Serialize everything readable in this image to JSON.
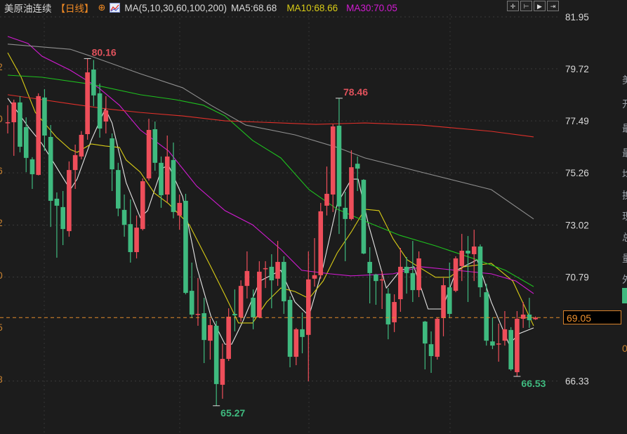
{
  "header": {
    "symbol": "美原油连续",
    "period": "【日线】",
    "crosshair_icon": "target-icon",
    "indicator_icon": "indicator-chart-icon",
    "indicator": "MA(5,10,30,60,100,200)",
    "ma5": "MA5:68.68",
    "ma10": "MA10:68.66",
    "ma30": "MA30:70.05",
    "tools": [
      "crosshair-icon",
      "zoom-range-icon",
      "play-icon",
      "jump-end-icon"
    ]
  },
  "colors": {
    "background": "#1c1c1c",
    "up": "#ee4e5a",
    "down": "#3fba7f",
    "ma5": "#e6e6e6",
    "ma10": "#d9cc16",
    "ma30": "#d21bd2",
    "ma_green": "#1ec01e",
    "ma_red": "#e0302a",
    "ma_gray": "#8f8f8f",
    "last_price": "#e28a2b"
  },
  "left_axis_fragments": [
    "2",
    "0",
    "6",
    "2",
    "0",
    "5",
    "8"
  ],
  "right_panel_fragments": [
    "美",
    "开",
    "最",
    "最",
    "均",
    "换",
    "现",
    "总",
    "量",
    "外",
    "0"
  ],
  "chart_data": {
    "type": "candlestick",
    "y_axis": {
      "ticks": [
        "81.95",
        "79.72",
        "77.49",
        "75.26",
        "73.02",
        "70.79",
        "66.33"
      ],
      "range": [
        64.9,
        82.1
      ],
      "position": "right"
    },
    "grid": true,
    "last_price": "69.05",
    "annotations": [
      {
        "text": "80.16",
        "index": 13,
        "kind": "high"
      },
      {
        "text": "78.46",
        "index": 54,
        "kind": "high"
      },
      {
        "text": "65.27",
        "index": 34,
        "kind": "low"
      },
      {
        "text": "66.53",
        "index": 83,
        "kind": "low"
      }
    ],
    "ohlc": [
      [
        77.4,
        78.16,
        76.95,
        77.43
      ],
      [
        77.43,
        78.4,
        75.99,
        78.28
      ],
      [
        78.28,
        78.55,
        76.14,
        76.38
      ],
      [
        77.22,
        77.64,
        75.29,
        75.9
      ],
      [
        75.84,
        75.93,
        74.57,
        75.2
      ],
      [
        75.17,
        78.67,
        75.15,
        78.55
      ],
      [
        78.49,
        78.85,
        76.2,
        76.86
      ],
      [
        76.8,
        77.31,
        72.94,
        74.06
      ],
      [
        74.15,
        74.42,
        71.62,
        73.85
      ],
      [
        73.79,
        74.48,
        72.16,
        72.85
      ],
      [
        72.76,
        75.75,
        72.52,
        75.38
      ],
      [
        75.38,
        76.47,
        74.57,
        76.02
      ],
      [
        75.96,
        77.05,
        75.84,
        76.89
      ],
      [
        76.92,
        80.16,
        76.68,
        79.57
      ],
      [
        79.69,
        80.1,
        78.12,
        78.58
      ],
      [
        78.67,
        79.09,
        76.77,
        77.16
      ],
      [
        77.46,
        78.55,
        76.95,
        77.94
      ],
      [
        76.74,
        76.95,
        74.48,
        75.41
      ],
      [
        75.38,
        75.69,
        73.4,
        73.73
      ],
      [
        73.67,
        74.33,
        72.52,
        73.03
      ],
      [
        73.06,
        74.12,
        71.41,
        71.86
      ],
      [
        71.86,
        73.43,
        71.59,
        72.91
      ],
      [
        72.85,
        75.02,
        72.79,
        74.9
      ],
      [
        75.02,
        77.58,
        74.93,
        77.1
      ],
      [
        77.13,
        77.46,
        75.35,
        75.69
      ],
      [
        75.69,
        75.96,
        73.76,
        74.3
      ],
      [
        74.33,
        76.86,
        74.0,
        75.96
      ],
      [
        75.81,
        76.56,
        73.31,
        73.58
      ],
      [
        73.43,
        74.33,
        72.82,
        73.97
      ],
      [
        74.06,
        74.36,
        70.05,
        70.11
      ],
      [
        70.2,
        71.41,
        69.03,
        69.18
      ],
      [
        69.18,
        70.75,
        68.7,
        69.21
      ],
      [
        69.24,
        69.9,
        67.1,
        68.09
      ],
      [
        68.06,
        69.0,
        67.25,
        68.73
      ],
      [
        68.7,
        68.91,
        65.27,
        66.2
      ],
      [
        66.17,
        67.94,
        65.57,
        67.28
      ],
      [
        67.28,
        69.45,
        67.19,
        69.09
      ],
      [
        69.21,
        70.26,
        68.46,
        69.15
      ],
      [
        69.06,
        70.65,
        68.88,
        70.41
      ],
      [
        70.41,
        71.89,
        69.87,
        71.05
      ],
      [
        69.9,
        70.26,
        68.55,
        69.06
      ],
      [
        69.06,
        71.47,
        69.03,
        71.02
      ],
      [
        71.14,
        71.47,
        70.32,
        71.17
      ],
      [
        71.23,
        71.77,
        69.45,
        70.65
      ],
      [
        70.72,
        72.34,
        70.41,
        71.44
      ],
      [
        71.44,
        71.68,
        69.21,
        69.75
      ],
      [
        69.81,
        69.96,
        66.92,
        67.37
      ],
      [
        67.37,
        68.61,
        67.01,
        68.55
      ],
      [
        68.55,
        69.27,
        67.52,
        68.22
      ],
      [
        68.31,
        71.89,
        66.32,
        70.69
      ],
      [
        70.72,
        72.46,
        70.38,
        70.87
      ],
      [
        70.87,
        73.97,
        70.72,
        73.61
      ],
      [
        73.85,
        75.53,
        73.43,
        74.36
      ],
      [
        74.33,
        77.34,
        73.58,
        77.25
      ],
      [
        77.28,
        78.46,
        72.64,
        73.82
      ],
      [
        73.76,
        74.45,
        71.47,
        73.28
      ],
      [
        73.28,
        76.23,
        73.22,
        75.5
      ],
      [
        75.65,
        75.96,
        74.48,
        75.44
      ],
      [
        74.96,
        74.99,
        71.77,
        71.8
      ],
      [
        71.44,
        72.07,
        69.66,
        70.96
      ],
      [
        70.9,
        70.93,
        69.6,
        70.62
      ],
      [
        70.65,
        71.05,
        69.42,
        70.69
      ],
      [
        70.08,
        70.32,
        68.12,
        68.76
      ],
      [
        68.85,
        70.05,
        68.43,
        69.72
      ],
      [
        69.84,
        72.04,
        69.3,
        71.23
      ],
      [
        71.23,
        71.65,
        70.08,
        70.96
      ],
      [
        70.96,
        72.34,
        69.72,
        70.23
      ],
      [
        70.23,
        71.89,
        69.93,
        71.59
      ],
      [
        68.88,
        68.91,
        66.83,
        67.94
      ],
      [
        67.91,
        68.46,
        66.68,
        67.4
      ],
      [
        67.37,
        69.06,
        67.25,
        69.0
      ],
      [
        69.03,
        70.75,
        68.25,
        70.44
      ],
      [
        70.35,
        71.41,
        69.03,
        69.21
      ],
      [
        70.2,
        71.68,
        70.14,
        71.59
      ],
      [
        71.26,
        72.64,
        70.62,
        71.92
      ],
      [
        71.92,
        72.55,
        69.72,
        71.8
      ],
      [
        71.77,
        72.82,
        70.62,
        72.1
      ],
      [
        72.1,
        72.19,
        69.93,
        70.35
      ],
      [
        70.14,
        70.5,
        67.85,
        68.06
      ],
      [
        68.03,
        69.06,
        67.7,
        67.85
      ],
      [
        67.91,
        68.79,
        67.16,
        67.94
      ],
      [
        68.06,
        69.33,
        67.85,
        68.55
      ],
      [
        68.52,
        68.64,
        66.77,
        66.83
      ],
      [
        66.71,
        69.33,
        66.53,
        69.0
      ],
      [
        69.0,
        69.72,
        68.61,
        69.18
      ],
      [
        69.18,
        69.9,
        68.61,
        68.94
      ],
      [
        68.98,
        69.1,
        68.95,
        69.05
      ]
    ],
    "moving_averages": [
      {
        "name": "MA5",
        "color": "#e6e6e6",
        "points": [
          [
            0,
            78.46
          ],
          [
            3.3,
            77.25
          ],
          [
            5.6,
            76.5
          ],
          [
            10.2,
            74.54
          ],
          [
            11.3,
            74.99
          ],
          [
            13.6,
            76.65
          ],
          [
            15.9,
            78.01
          ],
          [
            17.0,
            77.4
          ],
          [
            19.3,
            74.84
          ],
          [
            21.6,
            73.34
          ],
          [
            22.8,
            73.64
          ],
          [
            25.1,
            75.44
          ],
          [
            26.2,
            75.59
          ],
          [
            28.5,
            74.24
          ],
          [
            30.8,
            71.23
          ],
          [
            33.1,
            69.12
          ],
          [
            35.4,
            67.91
          ],
          [
            36.5,
            67.91
          ],
          [
            38.2,
            68.82
          ],
          [
            41.1,
            70.62
          ],
          [
            44.5,
            71.08
          ],
          [
            46.8,
            69.72
          ],
          [
            49.1,
            69.12
          ],
          [
            51.4,
            71.23
          ],
          [
            53.7,
            73.94
          ],
          [
            56.0,
            74.99
          ],
          [
            57.1,
            74.99
          ],
          [
            58.8,
            73.03
          ],
          [
            61.7,
            70.32
          ],
          [
            64.0,
            71.08
          ],
          [
            66.2,
            71.23
          ],
          [
            68.5,
            69.42
          ],
          [
            70.8,
            69.42
          ],
          [
            73.1,
            71.08
          ],
          [
            76.5,
            71.53
          ],
          [
            78.8,
            69.72
          ],
          [
            81.7,
            67.91
          ],
          [
            83.4,
            68.37
          ],
          [
            85.7,
            68.61
          ]
        ]
      },
      {
        "name": "MA10",
        "color": "#d9cc16",
        "points": [
          [
            0,
            80.41
          ],
          [
            2.2,
            79.36
          ],
          [
            4.5,
            77.85
          ],
          [
            7.9,
            76.8
          ],
          [
            10.2,
            76.26
          ],
          [
            11.3,
            76.14
          ],
          [
            13.6,
            76.5
          ],
          [
            15.9,
            76.41
          ],
          [
            18.2,
            76.35
          ],
          [
            19.3,
            75.81
          ],
          [
            21.6,
            75.29
          ],
          [
            23.9,
            74.39
          ],
          [
            26.2,
            73.94
          ],
          [
            29.6,
            73.03
          ],
          [
            33.1,
            71.23
          ],
          [
            35.4,
            70.02
          ],
          [
            37.6,
            68.82
          ],
          [
            39.9,
            68.82
          ],
          [
            42.2,
            69.72
          ],
          [
            44.5,
            70.32
          ],
          [
            46.8,
            70.17
          ],
          [
            49.1,
            69.87
          ],
          [
            51.4,
            70.62
          ],
          [
            53.7,
            71.83
          ],
          [
            56.0,
            72.73
          ],
          [
            58.2,
            73.7
          ],
          [
            60.5,
            73.64
          ],
          [
            62.8,
            72.43
          ],
          [
            65.1,
            71.53
          ],
          [
            69.7,
            70.78
          ],
          [
            72.0,
            70.78
          ],
          [
            74.3,
            71.23
          ],
          [
            78.8,
            71.38
          ],
          [
            82.3,
            70.62
          ],
          [
            85.7,
            68.7
          ]
        ]
      },
      {
        "name": "MA30",
        "color": "#d21bd2",
        "points": [
          [
            0,
            81.11
          ],
          [
            3.3,
            80.81
          ],
          [
            5.6,
            80.26
          ],
          [
            10.2,
            79.66
          ],
          [
            14.8,
            78.91
          ],
          [
            18.2,
            78.16
          ],
          [
            21.6,
            77.1
          ],
          [
            26.2,
            76.2
          ],
          [
            30.8,
            74.69
          ],
          [
            35.4,
            73.64
          ],
          [
            39.9,
            73.03
          ],
          [
            44.5,
            71.98
          ],
          [
            47.9,
            71.08
          ],
          [
            52.5,
            70.93
          ],
          [
            55.9,
            70.84
          ],
          [
            62.8,
            70.93
          ],
          [
            67.4,
            71.23
          ],
          [
            73.1,
            71.08
          ],
          [
            78.8,
            70.93
          ],
          [
            82.8,
            70.62
          ],
          [
            85.7,
            70.08
          ]
        ]
      },
      {
        "color": "#1ec01e",
        "points": [
          [
            0,
            79.45
          ],
          [
            5.6,
            79.36
          ],
          [
            13.6,
            79.06
          ],
          [
            21.6,
            78.61
          ],
          [
            27.3,
            78.4
          ],
          [
            31.9,
            78.16
          ],
          [
            35.4,
            77.7
          ],
          [
            39.9,
            76.65
          ],
          [
            44.5,
            75.9
          ],
          [
            49.1,
            74.54
          ],
          [
            53.7,
            73.7
          ],
          [
            58.2,
            73.19
          ],
          [
            63.9,
            72.58
          ],
          [
            69.7,
            72.13
          ],
          [
            76.5,
            71.53
          ],
          [
            81.1,
            71.08
          ],
          [
            85.7,
            70.38
          ]
        ]
      },
      {
        "color": "#e0302a",
        "points": [
          [
            0,
            78.61
          ],
          [
            5.6,
            78.4
          ],
          [
            10.2,
            78.22
          ],
          [
            15.9,
            78.01
          ],
          [
            21.6,
            77.85
          ],
          [
            28.5,
            77.7
          ],
          [
            35.4,
            77.49
          ],
          [
            44.5,
            77.4
          ],
          [
            50.2,
            77.34
          ],
          [
            58.2,
            77.4
          ],
          [
            67.4,
            77.31
          ],
          [
            78.8,
            77.04
          ],
          [
            85.7,
            76.8
          ]
        ]
      },
      {
        "color": "#8f8f8f",
        "points": [
          [
            0,
            80.78
          ],
          [
            10.2,
            80.56
          ],
          [
            13.6,
            80.26
          ],
          [
            21.6,
            79.51
          ],
          [
            28.5,
            78.91
          ],
          [
            33.1,
            78.16
          ],
          [
            38.8,
            77.31
          ],
          [
            46.8,
            76.89
          ],
          [
            53.7,
            76.35
          ],
          [
            58.2,
            75.9
          ],
          [
            67.4,
            75.29
          ],
          [
            78.8,
            74.54
          ],
          [
            85.7,
            73.28
          ]
        ]
      }
    ]
  }
}
